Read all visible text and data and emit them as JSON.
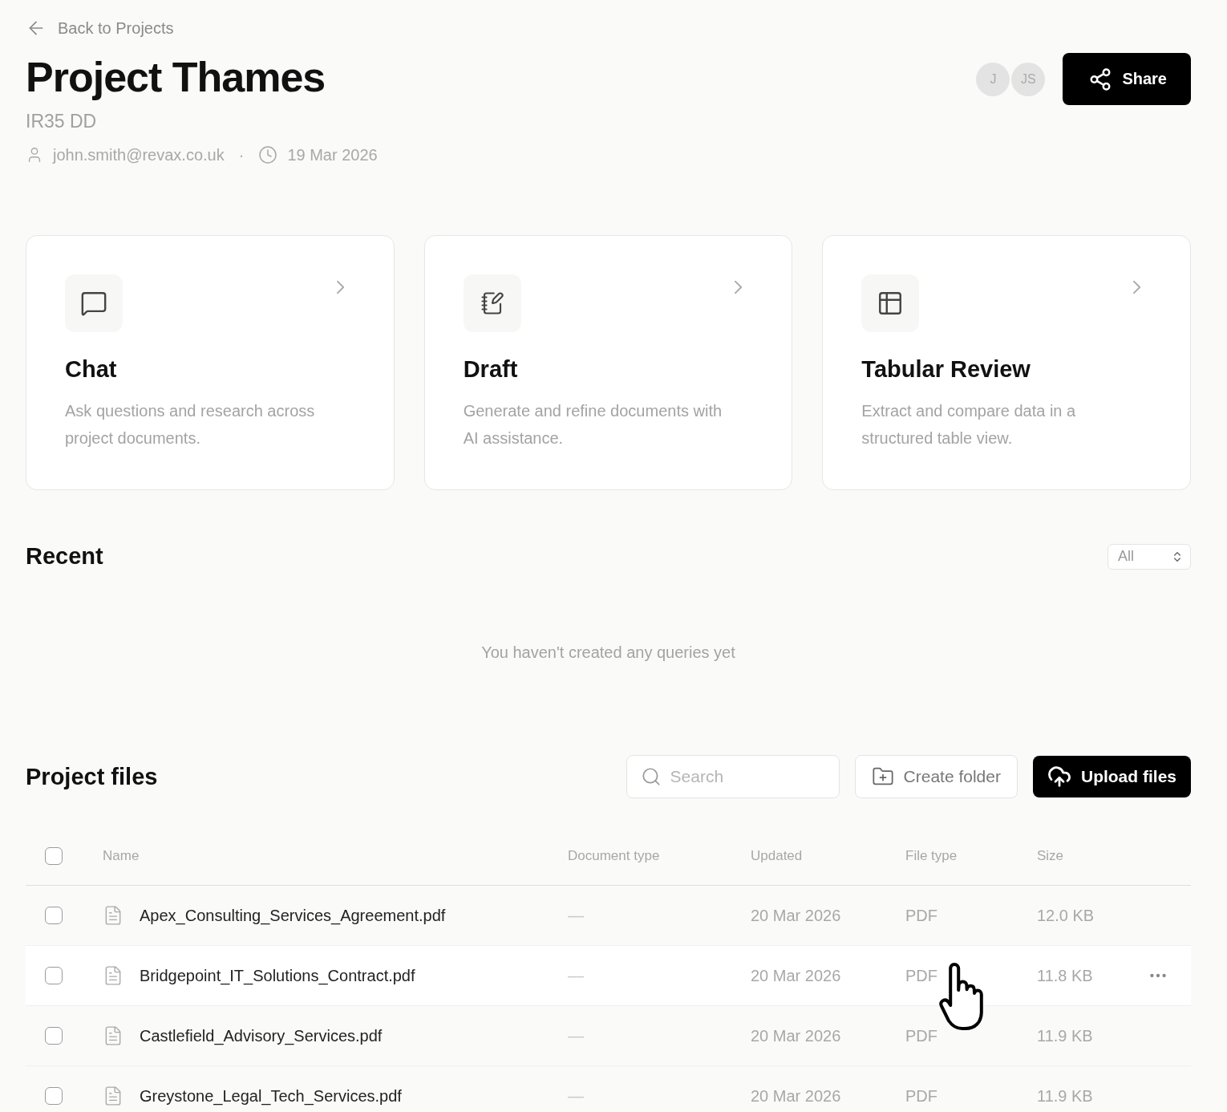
{
  "back_link": {
    "label": "Back to Projects"
  },
  "project": {
    "title": "Project Thames",
    "subtitle": "IR35 DD",
    "owner": "john.smith@revax.co.uk",
    "separator": "·",
    "date": "19 Mar 2026"
  },
  "members": [
    "J",
    "JS"
  ],
  "share_button": {
    "label": "Share"
  },
  "cards": [
    {
      "kind": "chat",
      "title": "Chat",
      "description": "Ask questions and research across project documents."
    },
    {
      "kind": "draft",
      "title": "Draft",
      "description": "Generate and refine documents with AI assistance."
    },
    {
      "kind": "table",
      "title": "Tabular Review",
      "description": "Extract and compare data in a structured table view."
    }
  ],
  "recent": {
    "title": "Recent",
    "filter": "All",
    "empty_message": "You haven't created any queries yet"
  },
  "files": {
    "title": "Project files",
    "search": {
      "placeholder": "Search"
    },
    "create_folder": "Create folder",
    "upload": "Upload files",
    "header_checked": false,
    "columns": [
      "Name",
      "Document type",
      "Updated",
      "File type",
      "Size"
    ],
    "rows": [
      {
        "name": "Apex_Consulting_Services_Agreement.pdf",
        "document_type": "—",
        "updated": "20 Mar 2026",
        "file_type": "PDF",
        "size": "12.0 KB",
        "checked": false,
        "hovered": false
      },
      {
        "name": "Bridgepoint_IT_Solutions_Contract.pdf",
        "document_type": "—",
        "updated": "20 Mar 2026",
        "file_type": "PDF",
        "size": "11.8 KB",
        "checked": false,
        "hovered": true
      },
      {
        "name": "Castlefield_Advisory_Services.pdf",
        "document_type": "—",
        "updated": "20 Mar 2026",
        "file_type": "PDF",
        "size": "11.9 KB",
        "checked": false,
        "hovered": false
      },
      {
        "name": "Greystone_Legal_Tech_Services.pdf",
        "document_type": "—",
        "updated": "20 Mar 2026",
        "file_type": "PDF",
        "size": "11.9 KB",
        "checked": false,
        "hovered": false
      }
    ]
  }
}
